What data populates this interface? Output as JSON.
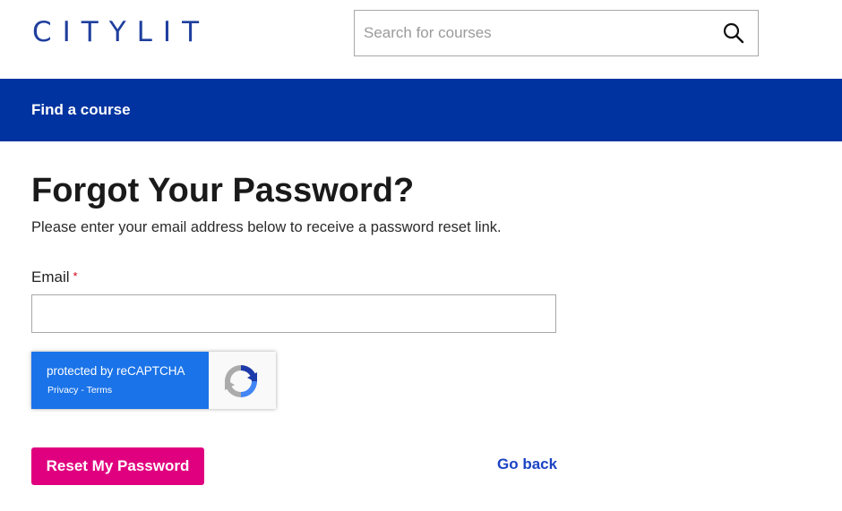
{
  "header": {
    "logo_text": "CITYLIT",
    "search": {
      "placeholder": "Search for courses",
      "value": "",
      "icon": "search-icon"
    }
  },
  "nav": {
    "items": [
      {
        "label": "Find a course"
      }
    ],
    "background": "#0033a0"
  },
  "main": {
    "title": "Forgot Your Password?",
    "subtitle": "Please enter your email address below to receive a password reset link.",
    "email": {
      "label": "Email",
      "required_marker": "*",
      "value": ""
    },
    "recaptcha": {
      "title": "protected by reCAPTCHA",
      "privacy_label": "Privacy",
      "separator": " - ",
      "terms_label": "Terms",
      "icon": "recaptcha-logo-icon"
    },
    "reset_button_label": "Reset My Password",
    "go_back_label": "Go back"
  },
  "colors": {
    "brand_blue": "#1f3f9e",
    "nav_blue": "#0033a0",
    "accent_pink": "#e0007f",
    "link_blue": "#1b43c4",
    "recaptcha_blue": "#1a73e8"
  }
}
